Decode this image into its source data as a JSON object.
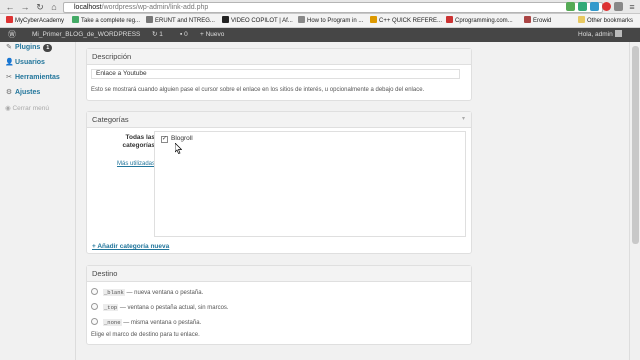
{
  "browser": {
    "url_host": "localhost",
    "url_path": "/wordpress/wp-admin/link-add.php",
    "bookmarks": [
      {
        "label": "MyCyberAcademy",
        "color": "#d33"
      },
      {
        "label": "Take a complete reg...",
        "color": "#4a6"
      },
      {
        "label": "ERUNT and NTREG...",
        "color": "#777"
      },
      {
        "label": "VIDEO COPILOT | Af...",
        "color": "#222"
      },
      {
        "label": "How to Program in ...",
        "color": "#888"
      },
      {
        "label": "C++ QUICK REFERE...",
        "color": "#d90"
      },
      {
        "label": "Cprogramming.com...",
        "color": "#c33"
      },
      {
        "label": "Erowid",
        "color": "#a44"
      }
    ],
    "other_bookmarks": "Other bookmarks"
  },
  "adminbar": {
    "site_name": "Mi_Primer_BLOG_de_WORDPRESS",
    "updates_count": "1",
    "comments_count": "0",
    "new_label": "Nuevo",
    "greeting": "Hola, admin"
  },
  "sidebar": {
    "items": [
      {
        "label": "Plugins",
        "badge": "1"
      },
      {
        "label": "Usuarios"
      },
      {
        "label": "Herramientas"
      },
      {
        "label": "Ajustes"
      }
    ],
    "collapse_label": "Cerrar menú"
  },
  "descripcion": {
    "title": "Descripción",
    "value": "Enlace a Youtube",
    "help": "Esto se mostrará cuando alguien pase el cursor sobre el enlace en los sitios de interés, u opcionalmente a debajo del enlace."
  },
  "categorias": {
    "title": "Categorías",
    "tab_all": "Todas las categorías",
    "tab_popular": "Más utilizadas",
    "items": [
      {
        "label": "Blogroll",
        "checked": "✓"
      }
    ],
    "add_new": "+ Añadir categoría nueva"
  },
  "destino": {
    "title": "Destino",
    "options": [
      {
        "code": "_blank",
        "text": "— nueva ventana o pestaña."
      },
      {
        "code": "_top",
        "text": "— ventana o pestaña actual, sin marcos."
      },
      {
        "code": "_none",
        "text": "— misma ventana o pestaña."
      }
    ],
    "help": "Elige el marco de destino para tu enlace."
  }
}
